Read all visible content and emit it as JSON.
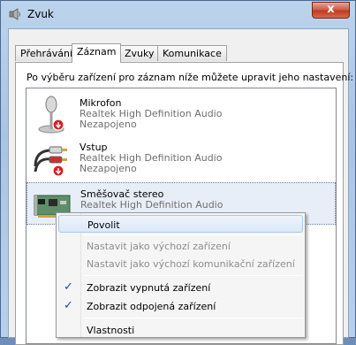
{
  "window": {
    "title": "Zvuk",
    "close_glyph": "x"
  },
  "tabs": [
    {
      "label": "Přehrávání"
    },
    {
      "label": "Záznam"
    },
    {
      "label": "Zvuky"
    },
    {
      "label": "Komunikace"
    }
  ],
  "instruction": "Po výběru zařízení pro záznam níže můžete upravit jeho nastavení:",
  "devices": [
    {
      "name": "Mikrofon",
      "driver": "Realtek High Definition Audio",
      "status": "Nezapojeno",
      "icon": "microphone-icon"
    },
    {
      "name": "Vstup",
      "driver": "Realtek High Definition Audio",
      "status": "Nezapojeno",
      "icon": "audio-cable-icon"
    },
    {
      "name": "Směšovač stereo",
      "driver": "Realtek High Definition Audio",
      "status": "",
      "icon": "sound-card-icon"
    }
  ],
  "context_menu": {
    "items": [
      {
        "label": "Povolit"
      },
      {
        "label": "Nastavit jako výchozí zařízení"
      },
      {
        "label": "Nastavit jako výchozí komunikační zařízení"
      },
      {
        "label": "Zobrazit vypnutá zařízení",
        "check": "✓"
      },
      {
        "label": "Zobrazit odpojená zařízení",
        "check": "✓"
      },
      {
        "label": "Vlastnosti"
      }
    ]
  },
  "colors": {
    "accent": "#1b4ea3",
    "close_button": "#c13a1f",
    "disabled_text": "#8d8d8d",
    "secondary_text": "#6e6e6e"
  }
}
